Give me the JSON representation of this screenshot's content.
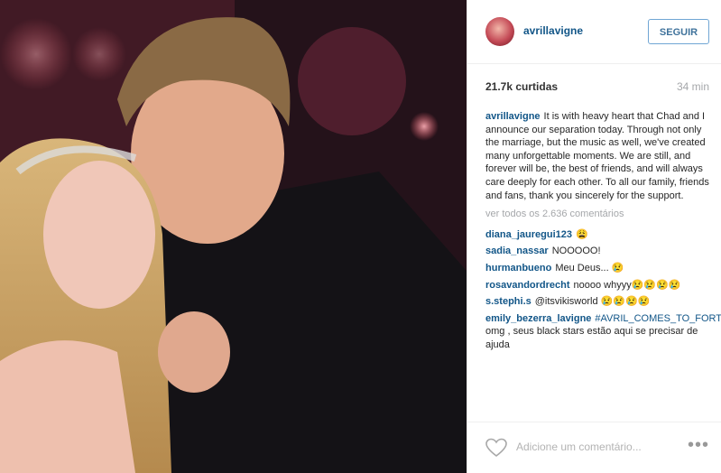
{
  "post": {
    "username": "avrillavigne",
    "follow_label": "SEGUIR",
    "likes": "21.7k curtidas",
    "time": "34 min",
    "caption_user": "avrillavigne",
    "caption_text": "It is with heavy heart that Chad and I announce our separation today. Through not only the marriage, but the music as well, we've created many unforgettable moments. We are still, and forever will be, the best of friends, and will always care deeply for each other. To all our family, friends and fans, thank you sincerely for the support.",
    "view_all": "ver todos os 2.636 comentários",
    "comments": [
      {
        "user": "diana_jauregui123",
        "text": "😩"
      },
      {
        "user": "sadia_nassar",
        "text": "NOOOOO!"
      },
      {
        "user": "hurmanbueno",
        "text": "Meu Deus... 😢"
      },
      {
        "user": "rosavandordrecht",
        "text": "noooo whyyy😢😢😢😢"
      },
      {
        "user": "s.stephi.s",
        "text": "@itsvikisworld 😢😢😢😢"
      }
    ],
    "last_comment": {
      "user": "emily_bezerra_lavigne",
      "tag": "#AVRIL_COMES_TO_FORTALEZA",
      "text": "omg , seus black stars estão aqui se precisar de ajuda"
    },
    "add_comment_placeholder": "Adicione um comentário...",
    "more_label": "•••",
    "icons": {
      "avatar": "profile-avatar",
      "heart": "heart-icon",
      "more": "more-options-icon"
    }
  }
}
